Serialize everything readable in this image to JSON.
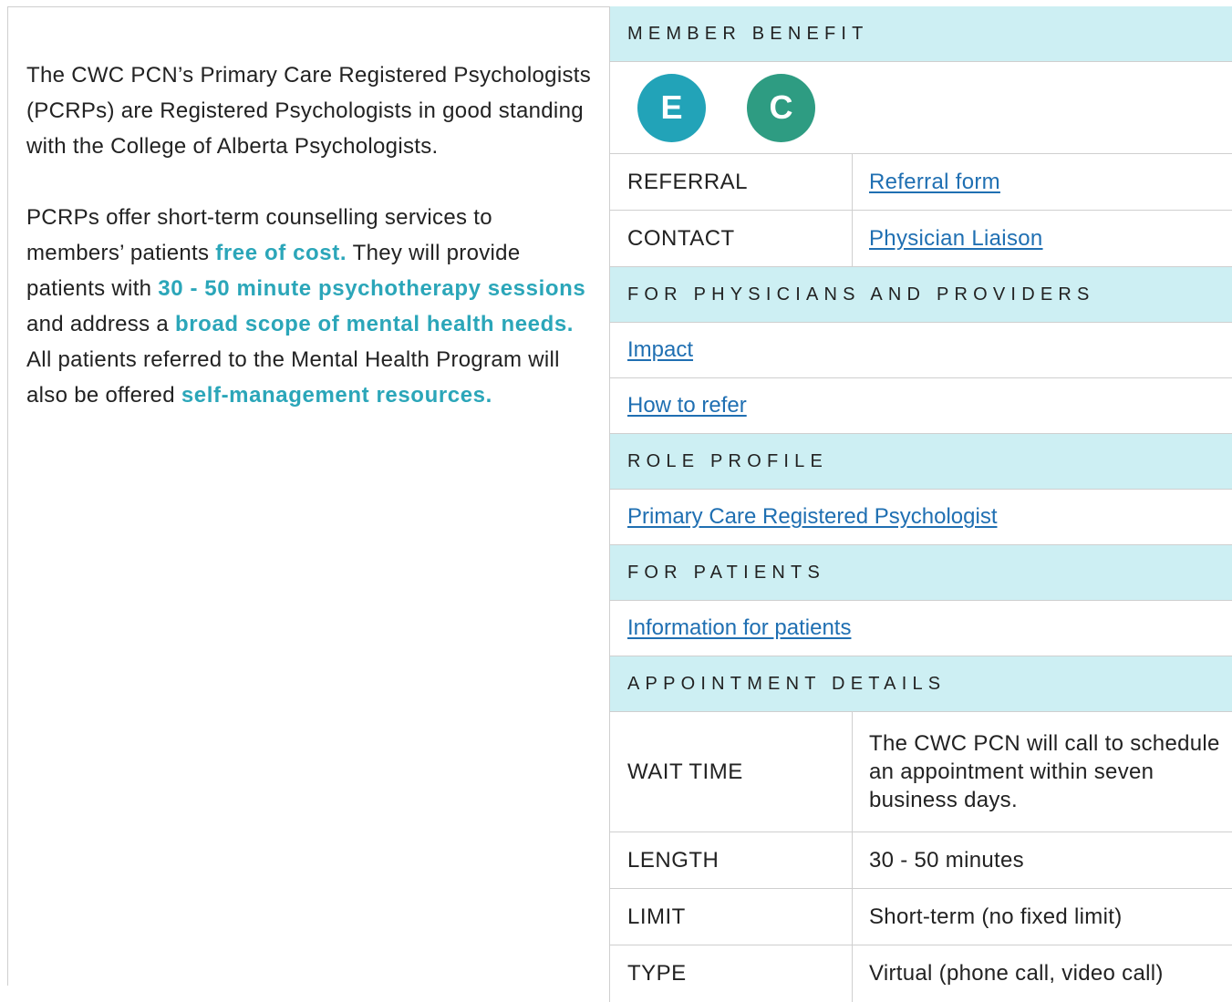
{
  "intro": {
    "p1": "The CWC PCN’s Primary Care Registered Psychologists (PCRPs) are Registered Psychologists in good standing with the College of Alberta Psychologists.",
    "p2_a": "PCRPs offer short-term counselling services to members’ patients ",
    "p2_hl1": "free of cost.",
    "p2_b": " They will provide patients with ",
    "p2_hl2": "30 - 50 minute psychotherapy sessions",
    "p2_c": " and address a ",
    "p2_hl3": "broad scope of mental health needs.",
    "p2_d": " All patients referred to the Mental Health Program will also be offered ",
    "p2_hl4": "self-management resources."
  },
  "sidebar": {
    "member_benefit": {
      "heading": "MEMBER BENEFIT",
      "badges": [
        {
          "letter": "E",
          "color": "#22a3b8"
        },
        {
          "letter": "C",
          "color": "#2e9c82"
        }
      ]
    },
    "referral": {
      "label": "REFERRAL",
      "link": "Referral form"
    },
    "contact": {
      "label": "CONTACT",
      "link": "Physician Liaison"
    },
    "physicians": {
      "heading": "FOR PHYSICIANS AND PROVIDERS",
      "links": [
        "Impact",
        "How to refer"
      ]
    },
    "role_profile": {
      "heading": "ROLE PROFILE",
      "link": "Primary Care Registered Psychologist"
    },
    "patients": {
      "heading": "FOR PATIENTS",
      "link": "Information for patients"
    },
    "appointment": {
      "heading": "APPOINTMENT DETAILS",
      "rows": [
        {
          "label": "WAIT TIME",
          "value": "The CWC PCN will call to schedule an appointment within seven business days."
        },
        {
          "label": "LENGTH",
          "value": "30 - 50 minutes"
        },
        {
          "label": "LIMIT",
          "value": "Short-term (no fixed limit)"
        },
        {
          "label": "TYPE",
          "value": "Virtual (phone call, video call)"
        }
      ]
    }
  }
}
